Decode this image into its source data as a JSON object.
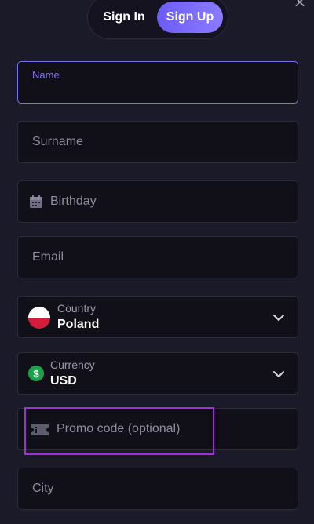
{
  "tabs": {
    "signin": "Sign In",
    "signup": "Sign Up"
  },
  "form": {
    "name_label": "Name",
    "surname_placeholder": "Surname",
    "birthday_placeholder": "Birthday",
    "email_placeholder": "Email",
    "country_label": "Country",
    "country_value": "Poland",
    "currency_label": "Currency",
    "currency_value": "USD",
    "promo_placeholder": "Promo code (optional)",
    "city_placeholder": "City"
  },
  "icons": {
    "close": "close-icon",
    "calendar": "calendar-icon",
    "country_flag": "poland-flag-icon",
    "currency": "dollar-icon",
    "dropdown": "chevron-down-icon",
    "promo": "ticket-icon"
  },
  "colors": {
    "background": "#1b1a29",
    "field_background": "#111019",
    "field_border": "#2d2c3c",
    "active_border": "#7a73e8",
    "accent": "#6c5cf6",
    "highlight": "#a22ed8"
  }
}
